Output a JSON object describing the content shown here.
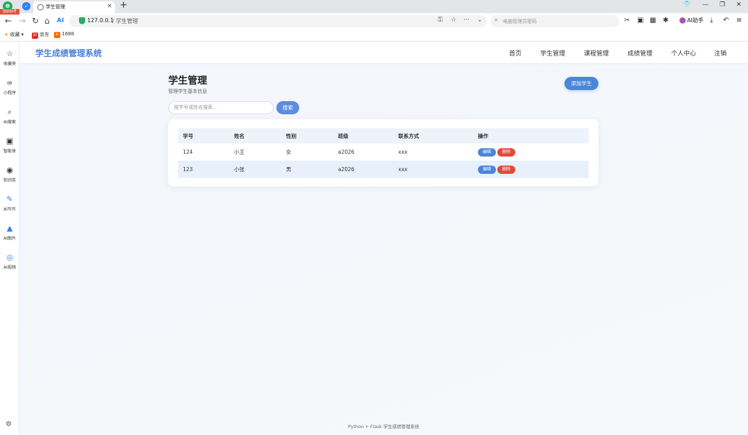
{
  "browser": {
    "badge": "智韵标号",
    "tab_title": "学生管理",
    "tab_close": "×",
    "new_tab": "+",
    "url_host": "127.0.0.1",
    "url_path": "/ 学生管理",
    "search_placeholder": "电脑管理员密码",
    "ai_helper": "AI助手",
    "bookmarks": [
      {
        "label": "收藏"
      },
      {
        "label": "京东"
      },
      {
        "label": "1688"
      }
    ]
  },
  "sidebar": {
    "items": [
      {
        "label": "收藏夹",
        "icon": "☆"
      },
      {
        "label": "小程序",
        "icon": "∞"
      },
      {
        "label": "AI搜索",
        "icon": "⌕"
      },
      {
        "label": "智能体",
        "icon": "▣"
      },
      {
        "label": "知识库",
        "icon": "◉"
      },
      {
        "label": "AI写作",
        "icon": "✎"
      },
      {
        "label": "AI图片",
        "icon": "▲"
      },
      {
        "label": "AI视频",
        "icon": "◎"
      }
    ]
  },
  "app": {
    "brand": "学生成绩管理系统",
    "nav": [
      "首页",
      "学生管理",
      "课程管理",
      "成绩管理",
      "个人中心",
      "注销"
    ],
    "page_title": "学生管理",
    "page_subtitle": "管理学生基本信息",
    "add_button": "添加学生",
    "search": {
      "placeholder": "按学号或姓名搜索...",
      "value": "",
      "button": "搜索"
    },
    "table": {
      "headers": [
        "学号",
        "姓名",
        "性别",
        "班级",
        "联系方式",
        "操作"
      ],
      "rows": [
        {
          "id": "124",
          "name": "小王",
          "gender": "女",
          "class": "a2026",
          "contact": "xxx",
          "edit": "编辑",
          "delete": "删除"
        },
        {
          "id": "123",
          "name": "小张",
          "gender": "男",
          "class": "a2026",
          "contact": "xxx",
          "edit": "编辑",
          "delete": "删除"
        }
      ]
    },
    "footer": "Python + Flask 学生成绩管理系统"
  },
  "colors": {
    "brand": "#4a7fd6",
    "primary_button": "#4a86d9",
    "danger_button": "#e04a3d",
    "table_header_bg": "#eef3fb",
    "highlight_row_bg": "#e8f0fc"
  }
}
